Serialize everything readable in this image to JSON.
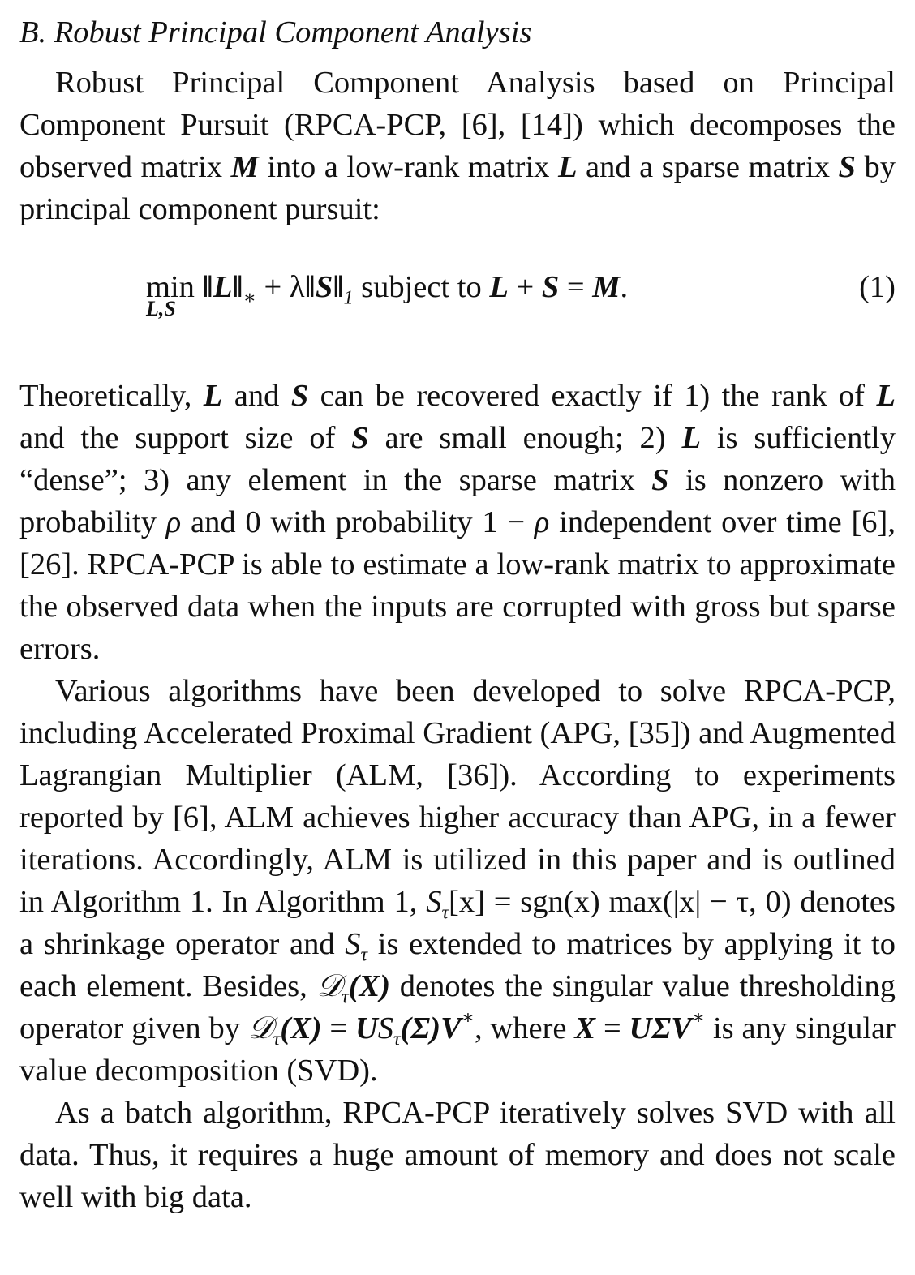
{
  "section": {
    "heading": "B. Robust Principal Component Analysis"
  },
  "p1": {
    "t1": "Robust Principal Component Analysis based on Principal Component Pursuit (RPCA-PCP, [6], [14]) which decomposes the observed matrix ",
    "M": "M",
    "t2": " into a low-rank matrix ",
    "L": "L",
    "t3": " and a sparse matrix ",
    "S": "S",
    "t4": " by principal component pursuit:"
  },
  "equation": {
    "min": "min",
    "min_sub": "L,S",
    "norm_L": "‖L‖",
    "star": "∗",
    "plus_lambda": " + λ",
    "norm_S": "‖S‖",
    "one": "1",
    "subject_to": " subject to ",
    "L": "L",
    "plus": " + ",
    "S": "S",
    "eq": " = ",
    "M": "M",
    "period": ".",
    "number": "(1)"
  },
  "p2": {
    "t1": "Theoretically, ",
    "L1": "L",
    "t2": " and ",
    "S1": "S",
    "t3": " can be recovered exactly if 1) the rank of ",
    "L2": "L",
    "t4": " and the support size of ",
    "S2": "S",
    "t5": " are small enough; 2) ",
    "L3": "L",
    "t6": " is sufficiently “dense”; 3) any element in the sparse matrix ",
    "S3": "S",
    "t7": " is nonzero with probability ",
    "rho1": "ρ",
    "t8": " and 0 with probability 1 − ",
    "rho2": "ρ",
    "t9": " independent over time [6], [26]. RPCA-PCP is able to estimate a low-rank matrix to approximate the observed data when the inputs are corrupted with gross but sparse errors."
  },
  "p3": {
    "t1": "Various algorithms have been developed to solve RPCA-PCP, including Accelerated Proximal Gradient (APG, [35]) and Augmented Lagrangian Multiplier (ALM, [36]). According to experiments reported by [6], ALM achieves higher accuracy than APG, in a fewer iterations. Accordingly, ALM is utilized in this paper and is outlined in Algorithm 1. In Algorithm 1, ",
    "S_tau_x": "S",
    "tau1": "τ",
    "f1": "[x] = sgn(x) max(|x| − τ, 0)",
    "t2": " denotes a shrinkage operator and ",
    "S_tau2": "S",
    "tau2": "τ",
    "t3": " is extended to matrices by applying it to each element. Besides, ",
    "D1": "𝒟",
    "tau3": "τ",
    "X1": "(X)",
    "t4": " denotes the singular value thresholding operator given by ",
    "D2": "𝒟",
    "tau4": "τ",
    "X2": "(X)",
    "eq1": " = ",
    "U1": "U",
    "S_tau3": "S",
    "tau5": "τ",
    "Sigma1": "(Σ)",
    "V1": "V",
    "star1": "∗",
    "t5": ", where ",
    "X3": "X",
    "eq2": " = ",
    "USigmaV": "UΣV",
    "star2": "∗",
    "t6": " is any singular value decomposition (SVD)."
  },
  "p4": {
    "text": "As a batch algorithm, RPCA-PCP iteratively solves SVD with all data. Thus, it requires a huge amount of memory and does not scale well with big data."
  }
}
